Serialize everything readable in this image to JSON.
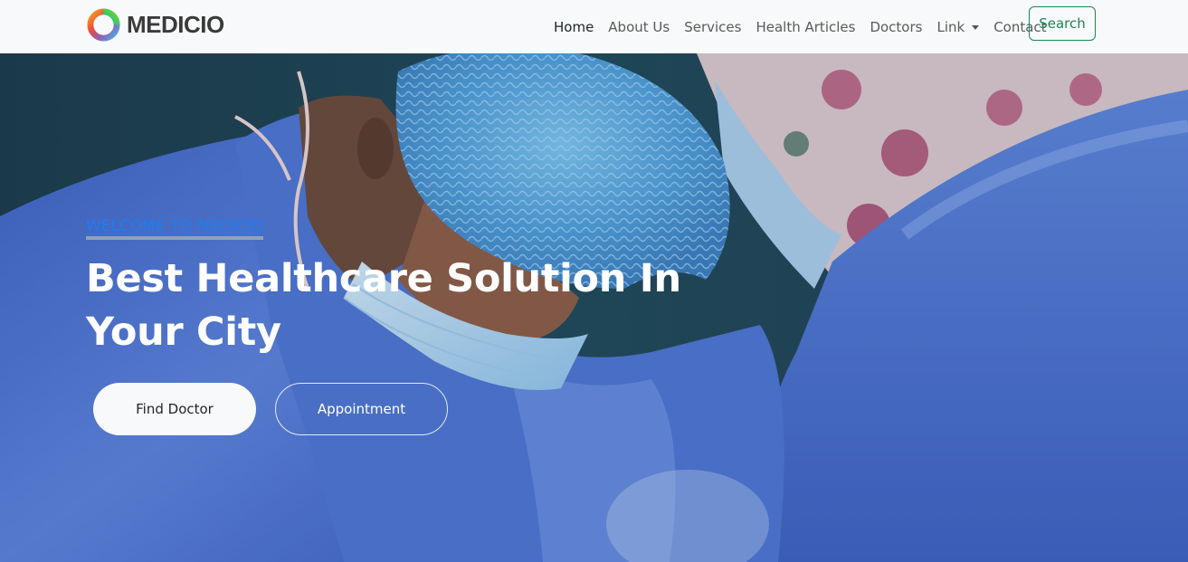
{
  "brand": {
    "name": "MEDICIO",
    "logo_icon": "ring-logo-icon"
  },
  "nav": {
    "items": [
      {
        "label": "Home",
        "active": true
      },
      {
        "label": "About Us"
      },
      {
        "label": "Services"
      },
      {
        "label": "Health Articles"
      },
      {
        "label": "Doctors"
      },
      {
        "label": "Link",
        "dropdown": true
      },
      {
        "label": "Contact"
      }
    ],
    "search_label": "Search"
  },
  "hero": {
    "eyebrow": "WELCOME TO MEDICIO",
    "headline": "Best Healthcare Solution In Your City",
    "primary_button": "Find Doctor",
    "secondary_button": "Appointment"
  },
  "colors": {
    "navbar_bg": "#f8f9fa",
    "accent_green": "#198754",
    "eyebrow_blue": "#1f7cf2",
    "gown_blue": "#4a6fd0",
    "scrub_cap_blue": "#5aa6e0"
  }
}
